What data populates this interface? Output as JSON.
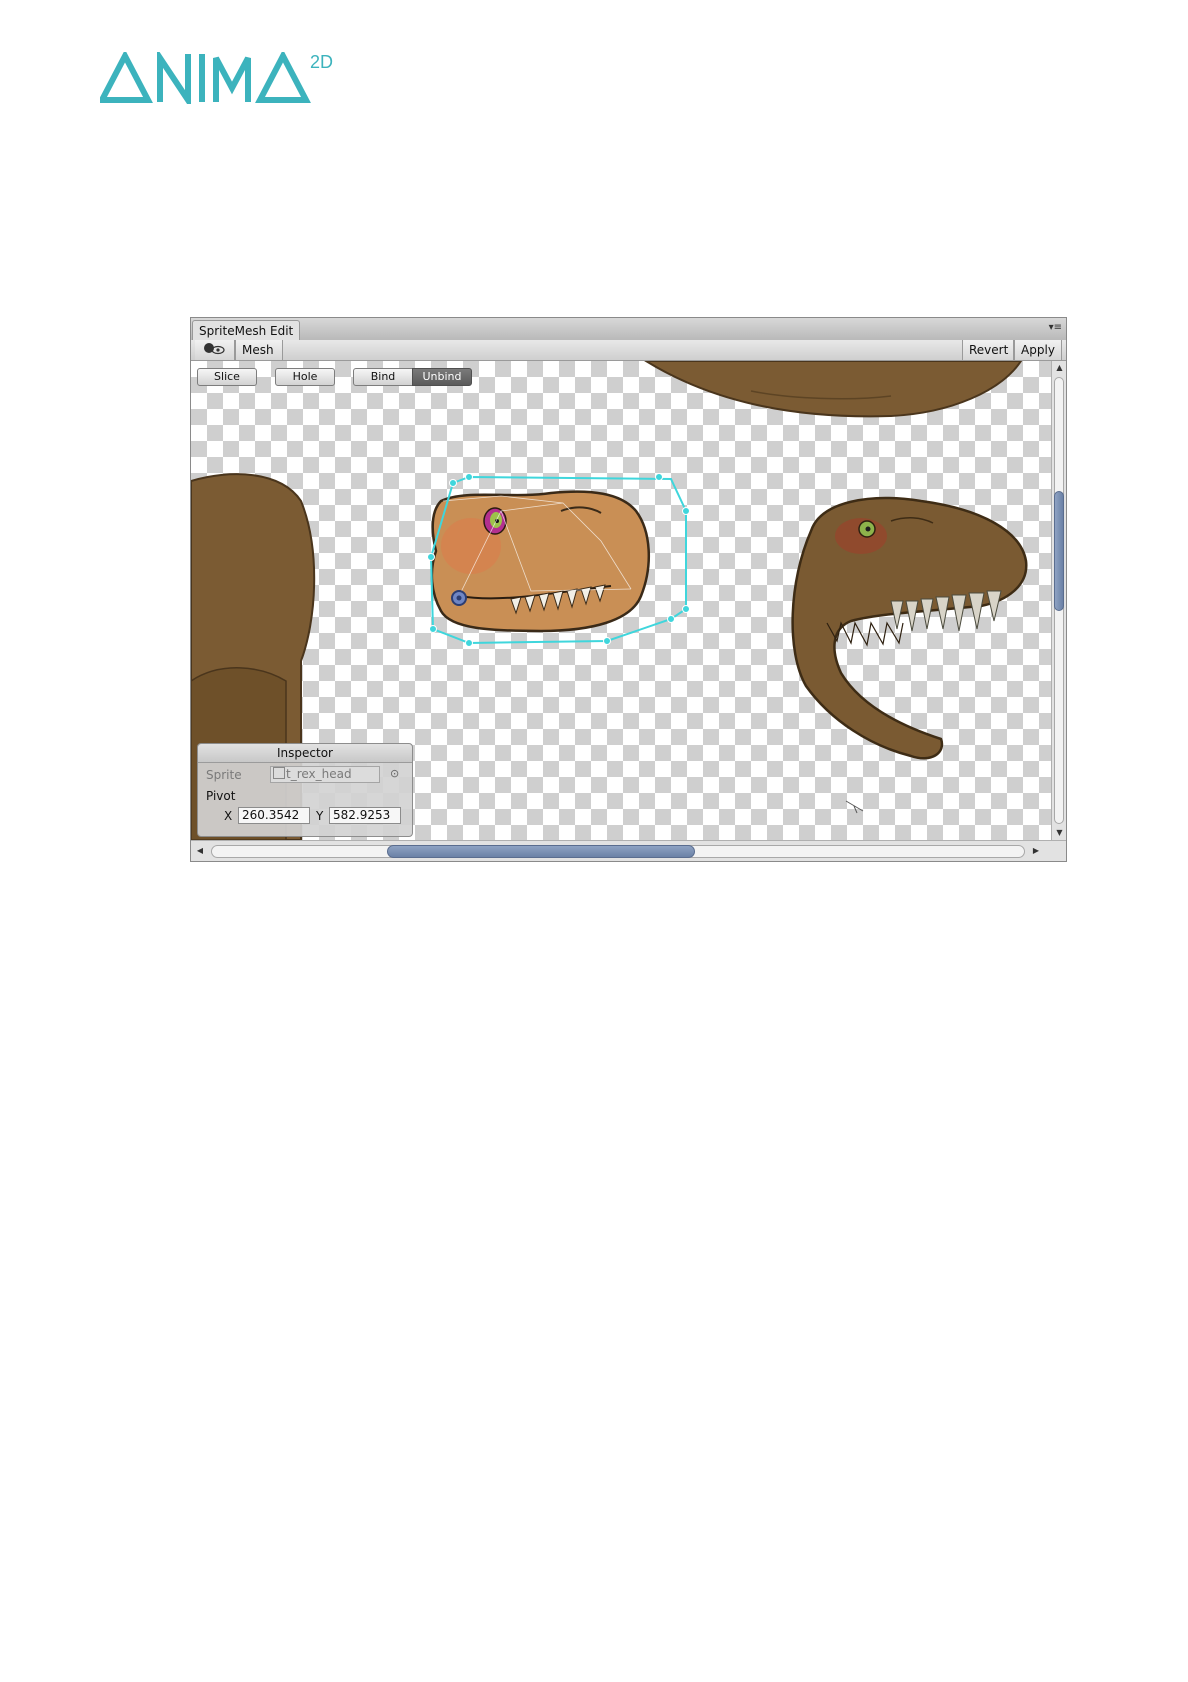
{
  "logo": {
    "text": "ANIMA",
    "superscript": "2D",
    "color": "#3cb3bd"
  },
  "window": {
    "tab_title": "SpriteMesh Edit",
    "toolbar": {
      "toggle_icon": "eye-toggle-icon",
      "mesh_label": "Mesh",
      "revert_label": "Revert",
      "apply_label": "Apply"
    },
    "mode_buttons": {
      "slice": "Slice",
      "hole": "Hole",
      "bind": "Bind",
      "unbind": "Unbind",
      "active": "Unbind"
    },
    "inspector": {
      "title": "Inspector",
      "sprite_label": "Sprite",
      "sprite_value": "t_rex_head",
      "pivot_label": "Pivot",
      "x_label": "X",
      "x_value": "260.3542",
      "y_label": "Y",
      "y_value": "582.9253"
    },
    "colors": {
      "mesh_outline": "#3fd6dc",
      "active_button": "#5f5f5f",
      "scroll_thumb": "#7a8fb3"
    }
  }
}
